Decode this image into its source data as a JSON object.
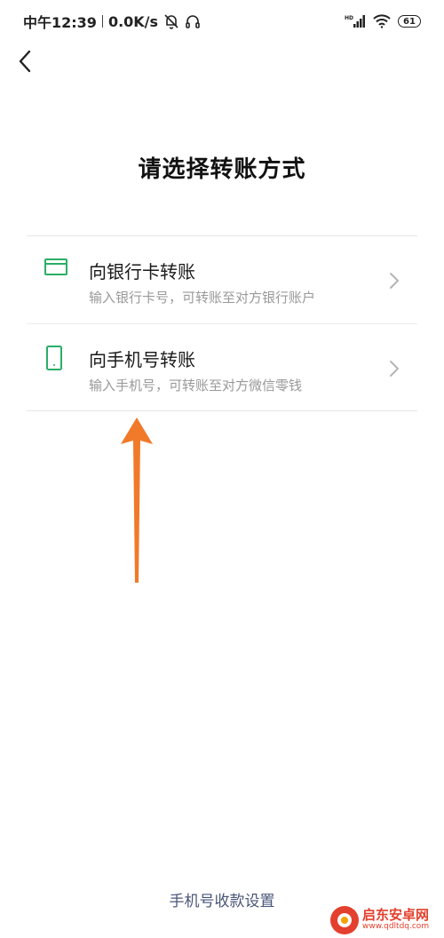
{
  "status_bar": {
    "time": "中午12:39",
    "net_speed": "0.0K/s",
    "signal_label": "HD",
    "battery": "61"
  },
  "header": {
    "title": "请选择转账方式"
  },
  "options": [
    {
      "icon": "bank-card-icon",
      "title": "向银行卡转账",
      "description": "输入银行卡号，可转账至对方银行账户"
    },
    {
      "icon": "phone-icon",
      "title": "向手机号转账",
      "description": "输入手机号，可转账至对方微信零钱"
    }
  ],
  "footer": {
    "link_label": "手机号收款设置"
  },
  "watermark": {
    "name": "启东安卓网",
    "url": "www.qdltdq.com"
  },
  "colors": {
    "accent_green": "#2aae67",
    "arrow_orange": "#f07a2a",
    "link_blue": "#4a5678"
  }
}
